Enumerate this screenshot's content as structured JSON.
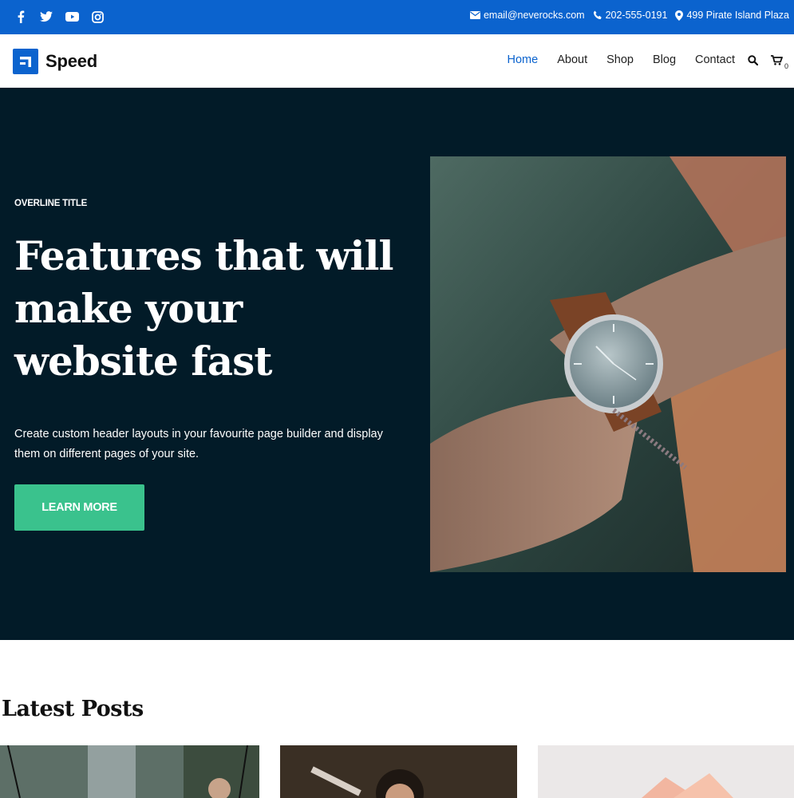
{
  "topbar": {
    "social": [
      {
        "icon": "facebook-icon"
      },
      {
        "icon": "twitter-icon"
      },
      {
        "icon": "youtube-icon"
      },
      {
        "icon": "instagram-icon"
      }
    ],
    "email": "email@neverocks.com",
    "phone": "202-555-0191",
    "address": "499 Pirate Island Plaza",
    "bg_color": "#0b63ce"
  },
  "header": {
    "brand": "Speed",
    "nav": [
      {
        "label": "Home",
        "active": true
      },
      {
        "label": "About"
      },
      {
        "label": "Shop"
      },
      {
        "label": "Blog"
      },
      {
        "label": "Contact"
      }
    ],
    "cart_count": "0",
    "accent_color": "#0b63ce"
  },
  "hero": {
    "overline": "OVERLINE TITLE",
    "headline": "Features that will make your website fast",
    "subtext": "Create custom header layouts in your favourite page builder and display them on different pages of your site.",
    "cta_label": "LEARN MORE",
    "bg_color": "#021b28",
    "cta_color": "#3ac28d"
  },
  "latest": {
    "title": "Latest Posts"
  }
}
